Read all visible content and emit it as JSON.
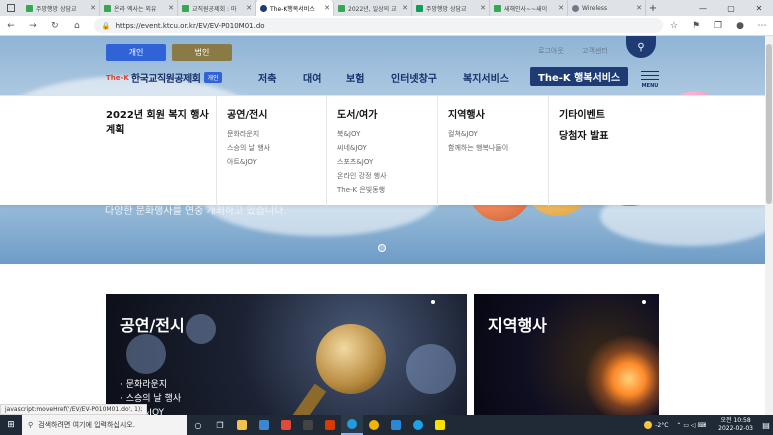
{
  "browser": {
    "tabs": [
      {
        "label": "주망행망 상담교",
        "color": "#34a853"
      },
      {
        "label": "온라 엑사는 외유",
        "color": "#34a853"
      },
      {
        "label": "교직원공제회 : 마",
        "color": "#34a853"
      },
      {
        "label": "The-K행복서비스",
        "color": "#1f3b73",
        "active": true
      },
      {
        "label": "2022년, 일상의 교",
        "color": "#34a853"
      },
      {
        "label": "주망행망 상담교",
        "color": "#0f9d58"
      },
      {
        "label": "새해인사~~새이",
        "color": "#34a853"
      },
      {
        "label": "Wireless",
        "color": "#6f7b86"
      }
    ],
    "url": "https://event.ktcu.or.kr/EV/EV-P010M01.do",
    "status_text": "javascript:moveHref('/EV/EV-P010M01.do', 1);"
  },
  "header": {
    "member_buttons": {
      "personal": "개인",
      "corporate": "법인"
    },
    "util_links": {
      "logout": "로그아웃",
      "customer_center": "고객센터"
    },
    "logo": {
      "mark": "The-K",
      "name": "한국교직원공제회",
      "badge": "개인"
    },
    "gnb": [
      "저축",
      "대여",
      "보험",
      "인터넷창구",
      "복지서비스",
      "The-K 행복서비스"
    ],
    "menu_label": "MENU"
  },
  "mega_menu": [
    {
      "title": "2022년 회원 복지 행사 계획",
      "items": []
    },
    {
      "title": "공연/전시",
      "items": [
        "문화라운지",
        "스승의 날 행사",
        "아트&JOY"
      ]
    },
    {
      "title": "도서/여가",
      "items": [
        "북&JOY",
        "씨네&JOY",
        "스포츠&JOY",
        "온라인 강정 행사",
        "The-K 은빛동행"
      ]
    },
    {
      "title": "지역행사",
      "items": [
        "컬쳐&JOY",
        "함께하는 행복나들이"
      ]
    },
    {
      "title": "기타이벤트",
      "items": []
    },
    {
      "title": "당첨자 발표",
      "items": []
    }
  ],
  "hero": {
    "text": "다양한 문화행사를 연중 개최하고 있습니다."
  },
  "cards": {
    "performance": {
      "title": "공연/전시",
      "items": [
        "· 문화라운지",
        "· 스승의 날 행사",
        "· 아트&JOY"
      ]
    },
    "regional": {
      "title": "지역행사"
    }
  },
  "taskbar": {
    "search_placeholder": "검색하려면 여기에 입력하십시오.",
    "weather": "-2°C",
    "time": "오전 10:58",
    "date": "2022-02-03"
  },
  "colors": {
    "brand_navy": "#1f3b73",
    "brand_blue": "#2f63d6",
    "corp_gold": "#8a7a45"
  }
}
